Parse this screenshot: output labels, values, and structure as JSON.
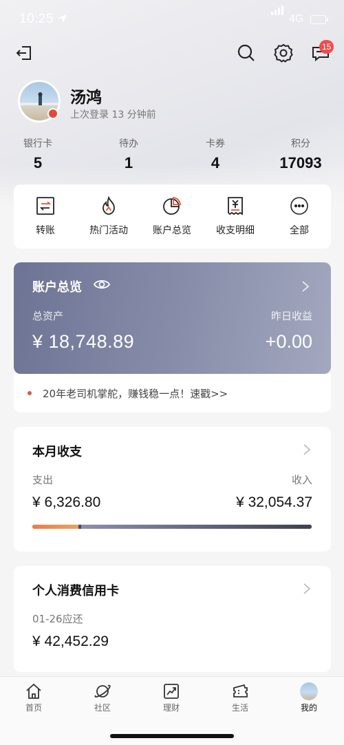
{
  "status_bar": {
    "time": "10:25",
    "network": "4G"
  },
  "header": {
    "message_badge": "15"
  },
  "profile": {
    "name": "汤鸿",
    "last_login": "上次登录 13 分钟前"
  },
  "stats": [
    {
      "label": "银行卡",
      "value": "5"
    },
    {
      "label": "待办",
      "value": "1"
    },
    {
      "label": "卡券",
      "value": "4"
    },
    {
      "label": "积分",
      "value": "17093"
    }
  ],
  "quick_actions": [
    {
      "label": "转账",
      "icon": "transfer-icon"
    },
    {
      "label": "热门活动",
      "icon": "flame-icon"
    },
    {
      "label": "账户总览",
      "icon": "pie-chart-icon"
    },
    {
      "label": "收支明细",
      "icon": "receipt-icon"
    },
    {
      "label": "全部",
      "icon": "more-icon"
    }
  ],
  "account": {
    "title": "账户总览",
    "total_assets_label": "总资产",
    "total_assets": "¥ 18,748.89",
    "yesterday_income_label": "昨日收益",
    "yesterday_income": "+0.00"
  },
  "notice": {
    "text": "20年老司机掌舵，赚钱稳一点！速戳>>"
  },
  "monthly": {
    "title": "本月收支",
    "expense_label": "支出",
    "expense": "¥ 6,326.80",
    "income_label": "收入",
    "income": "¥ 32,054.37",
    "expense_share": 0.165
  },
  "credit_card": {
    "title": "个人消费信用卡",
    "due_label": "01-26应还",
    "amount": "¥ 42,452.29"
  },
  "tabs": [
    {
      "label": "首页",
      "icon": "home-icon"
    },
    {
      "label": "社区",
      "icon": "planet-icon"
    },
    {
      "label": "理财",
      "icon": "trend-chart-icon"
    },
    {
      "label": "生活",
      "icon": "ticket-icon"
    },
    {
      "label": "我的",
      "icon": "avatar"
    }
  ],
  "colors": {
    "account_card": "#7a809e",
    "expense_bar": "#e77f45",
    "badge": "#ef4c4c"
  }
}
